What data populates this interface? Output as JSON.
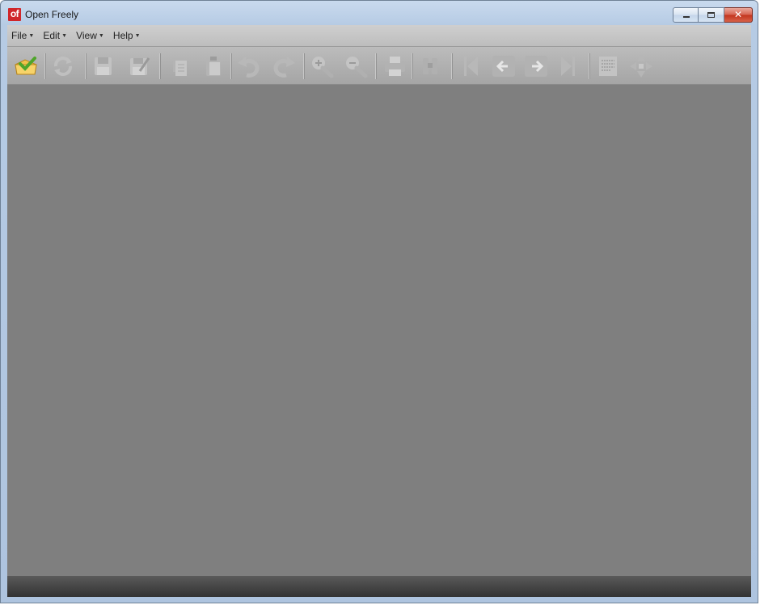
{
  "window": {
    "title": "Open Freely",
    "logo_text": "of",
    "controls": [
      "minimize",
      "maximize",
      "close"
    ]
  },
  "menu": {
    "items": [
      {
        "label": "File"
      },
      {
        "label": "Edit"
      },
      {
        "label": "View"
      },
      {
        "label": "Help"
      }
    ]
  },
  "toolbar": {
    "buttons": [
      {
        "icon": "open-folder-icon",
        "enabled": true
      },
      {
        "icon": "refresh-icon",
        "enabled": false
      },
      {
        "icon": "save-icon",
        "enabled": false
      },
      {
        "icon": "save-as-icon",
        "enabled": false
      },
      {
        "icon": "copy-icon",
        "enabled": false
      },
      {
        "icon": "paste-icon",
        "enabled": false
      },
      {
        "icon": "undo-icon",
        "enabled": false
      },
      {
        "icon": "redo-icon",
        "enabled": false
      },
      {
        "icon": "zoom-in-icon",
        "enabled": false
      },
      {
        "icon": "zoom-out-icon",
        "enabled": false
      },
      {
        "icon": "print-icon",
        "enabled": false
      },
      {
        "icon": "find-binoculars-icon",
        "enabled": false
      },
      {
        "icon": "first-page-icon",
        "enabled": false
      },
      {
        "icon": "previous-page-icon",
        "enabled": false
      },
      {
        "icon": "next-page-icon",
        "enabled": false
      },
      {
        "icon": "last-page-icon",
        "enabled": false
      },
      {
        "icon": "hex-view-icon",
        "enabled": false
      },
      {
        "icon": "fit-page-icon",
        "enabled": false
      }
    ]
  },
  "colors": {
    "workspace": "#7f7f7f",
    "toolbar_icon_disabled": "#bfbfbf",
    "logo_red": "#d0262a"
  }
}
